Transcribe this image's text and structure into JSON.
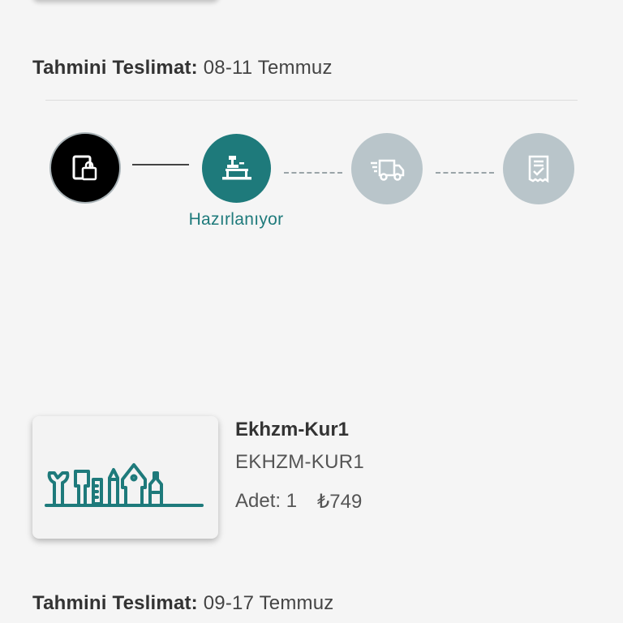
{
  "order": {
    "delivery_label": "Tahmini Teslimat:",
    "delivery_top": "08-11 Temmuz",
    "delivery_bottom": "09-17 Temmuz"
  },
  "tracking": {
    "steps": [
      {
        "icon": "order-confirmed-icon",
        "state": "done"
      },
      {
        "icon": "workbench-icon",
        "state": "active",
        "label": "Hazırlanıyor"
      },
      {
        "icon": "delivery-truck-icon",
        "state": "pending"
      },
      {
        "icon": "receipt-check-icon",
        "state": "pending"
      }
    ],
    "colors": {
      "done": "#000000",
      "active": "#1e7a7b",
      "pending": "#b9c5ca"
    }
  },
  "product": {
    "name": "Ekhzm-Kur1",
    "sku": "EKHZM-KUR1",
    "qty_text": "Adet: 1",
    "price": "₺749",
    "image_icon": "tools-illustration-icon"
  }
}
